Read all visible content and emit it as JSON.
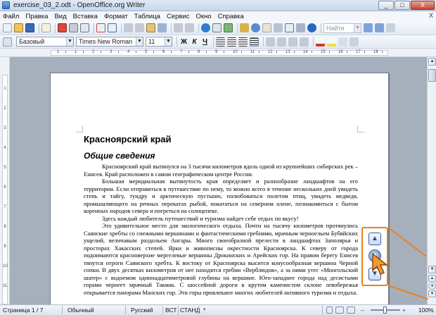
{
  "window": {
    "title": "exercise_03_2.odt - OpenOffice.org Writer",
    "buttons": [
      "_",
      "□",
      "X"
    ]
  },
  "menu": {
    "items": [
      "Файл",
      "Правка",
      "Вид",
      "Вставка",
      "Формат",
      "Таблица",
      "Сервис",
      "Окно",
      "Справка"
    ],
    "close_doc": "X"
  },
  "toolbar": {
    "find_placeholder": "Найти",
    "bold": "Ж",
    "italic": "К",
    "underline": "Ч"
  },
  "format_bar": {
    "style": "Базовый",
    "font": "Times New Roman",
    "size": "11"
  },
  "ruler": {
    "h_numbers": [
      "1",
      "1",
      "2",
      "3",
      "4",
      "5",
      "6",
      "7",
      "8",
      "9",
      "10",
      "11",
      "12",
      "13",
      "14",
      "15",
      "16",
      "17",
      "18"
    ],
    "v_numbers": [
      "1",
      "2",
      "3",
      "4",
      "5",
      "6",
      "7",
      "8",
      "9",
      "10",
      "11"
    ]
  },
  "document": {
    "heading": "Красноярский край",
    "subheading": "Общие сведения",
    "paragraphs": [
      "Красноярский край вытянулся на 3 тысячи километров вдоль одной из крупнейших сибирских рек – Енисея. Край расположен в самом географическом центре России.",
      "Большая меридиальная вытянутость края определяет и разнообразие ландшафтов на его территории. Если отправиться в путешествие по нему, то можно всего в течение нескольких дней увидеть степь и тайгу, тундру и арктическую пустыню, полюбоваться полетом птиц, увидеть медведя, промышляющего на речных перекатах рыбой, покататься на северном олене, познакомиться с бытом коренных народов севера и погреться на солнцепеке.",
      "Здесь каждый любитель путешествий и туризма найдет себе отдых по вкусу!",
      "Это удивительное место для экологического отдыха. Почти на тысячу километров протянулись Саянские хребты со снежными вершинами и фантастическими гребнями, мрачным черноельем Бубвйских ущелий, величавым раздольем Ангары. Много своеобразной прелести в ландшафтах Заполярья и просторах Хакасских степей. Ярки и живописны окрестности Красноярска. К северу от города поднимаются красноверхие мергелевые вершины Дрокинских и Арейских гор. На правом берегу Енисея тянутся отроги Саянского хребта. К востоку от Красноярска высится конусообразная вершина Черной сопки. В двух десятках километров от нее находятся гребни «Верблюдов», а за ними утес «Монгольский шатер» с водоемом одиннадцатиметровой глубины на вершине. Юго-западнее города над десистыми горами чернеет мрачный Такмак. С шоссейной дороги в крутом каменистом склоне левобережья открывается панорама Манских гор. Эти горы привлекают многих любителей активного туризма и отдыха."
    ]
  },
  "statusbar": {
    "page": "Страница  1 / 7",
    "style": "Обычный",
    "language": "Русский",
    "insert_mode": "ВСТ",
    "selection_mode": "СТАНД",
    "modified": "*",
    "zoom": "100%"
  },
  "colors": {
    "callout": "#e8821e",
    "nav_button": "#1e4fa0",
    "workspace": "#a6b0bd"
  }
}
